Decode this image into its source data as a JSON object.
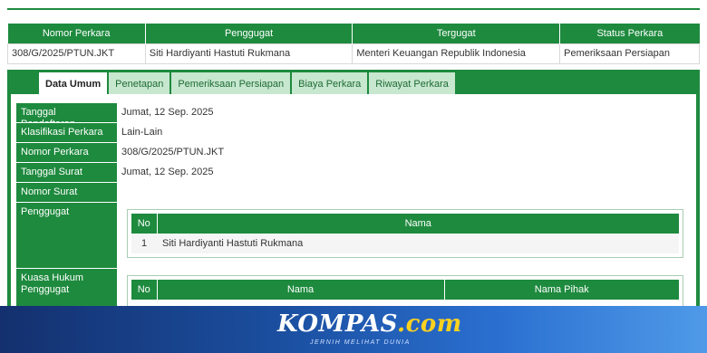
{
  "summary": {
    "headers": [
      "Nomor Perkara",
      "Penggugat",
      "Tergugat",
      "Status Perkara"
    ],
    "row": [
      "308/G/2025/PTUN.JKT",
      "Siti Hardiyanti Hastuti Rukmana",
      "Menteri Keuangan Republik Indonesia",
      "Pemeriksaan Persiapan"
    ]
  },
  "tabs": [
    "Data Umum",
    "Penetapan",
    "Pemeriksaan Persiapan",
    "Biaya Perkara",
    "Riwayat Perkara"
  ],
  "details": {
    "tanggal_pendaftaran": {
      "label": "Tanggal Pendaftaran",
      "value": "Jumat, 12 Sep. 2025"
    },
    "klasifikasi": {
      "label": "Klasifikasi Perkara",
      "value": "Lain-Lain"
    },
    "nomor_perkara": {
      "label": "Nomor Perkara",
      "value": "308/G/2025/PTUN.JKT"
    },
    "tanggal_surat": {
      "label": "Tanggal Surat",
      "value": "Jumat, 12 Sep. 2025"
    },
    "nomor_surat": {
      "label": "Nomor Surat",
      "value": ""
    },
    "penggugat_label": "Penggugat",
    "kuasa_label": "Kuasa Hukum Penggugat"
  },
  "penggugat_table": {
    "headers": [
      "No",
      "Nama"
    ],
    "rows": [
      [
        "1",
        "Siti Hardiyanti Hastuti Rukmana"
      ]
    ]
  },
  "kuasa_table": {
    "headers": [
      "No",
      "Nama",
      "Nama Pihak"
    ]
  },
  "banner": {
    "brand_main": "KOMPAS",
    "brand_suffix": ".com",
    "tagline": "JERNIH MELIHAT DUNIA"
  }
}
